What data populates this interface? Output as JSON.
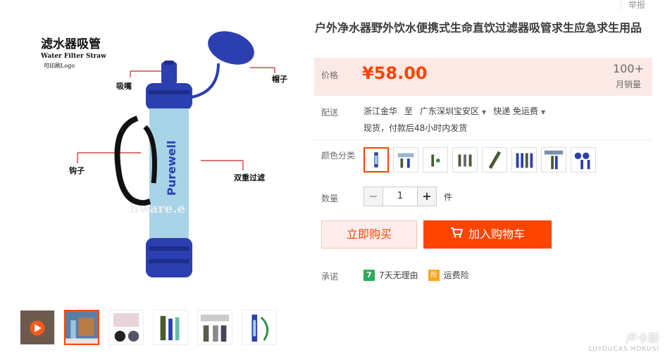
{
  "header": {
    "report_label": "举报"
  },
  "product": {
    "title": "户外净水器野外饮水便携式生命直饮过滤器吸管求生应急求生用品",
    "price_label": "价格",
    "price": "¥58.00",
    "sold_count": "100+",
    "sold_label": "月销量"
  },
  "main_image": {
    "title_cn": "滤水器吸管",
    "title_en": "Water Filter Straw",
    "logo_note": "可印刷Logo",
    "label_mouthpiece": "吸嘴",
    "label_cap": "帽子",
    "label_hook": "钩子",
    "label_filter": "双重过滤",
    "brand": "Purewell",
    "watermark_fragment": "hware.e"
  },
  "delivery": {
    "label": "配送",
    "from": "浙江金华",
    "to_word": "至",
    "to": "广东深圳宝安区",
    "shipping": "快递 免运费",
    "stock_note": "现货，付款后48小时内发货"
  },
  "color": {
    "label": "颜色分类",
    "swatch_count": 8
  },
  "quantity": {
    "label": "数量",
    "value": "1",
    "unit": "件",
    "minus": "−",
    "plus": "+"
  },
  "actions": {
    "buy_now": "立即购买",
    "add_cart": "加入购物车"
  },
  "promise": {
    "label": "承诺",
    "items": [
      {
        "badge": "7",
        "text": "7天无理由"
      },
      {
        "badge": "险",
        "text": "运费险"
      }
    ]
  },
  "colors": {
    "accent": "#ff4400",
    "price_bg": "#fbe9e5",
    "filter_blue": "#2b3fb0",
    "tube_blue": "#a8d4e8"
  },
  "watermark": {
    "text": "卢卡斯",
    "sub": "LUYOUCAS HOKUSI"
  }
}
